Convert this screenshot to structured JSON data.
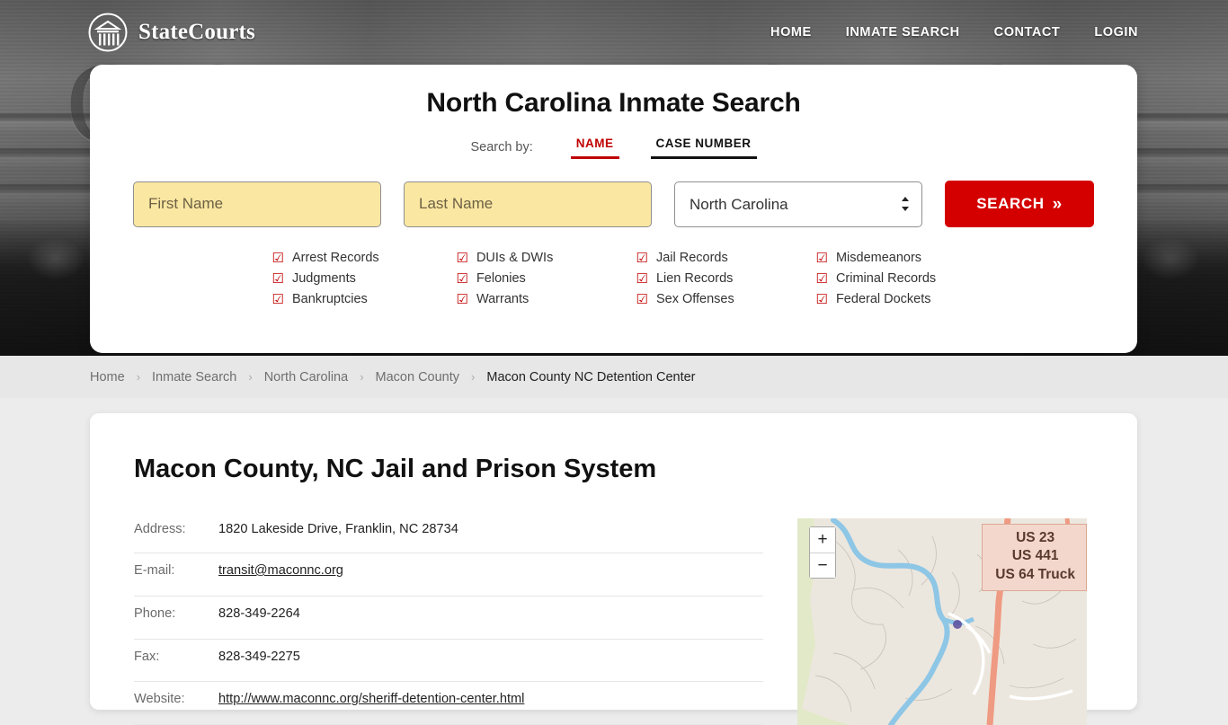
{
  "header": {
    "brand": "StateCourts",
    "logo_icon": "courthouse-logo-icon",
    "background_word": "COURTHOUSE",
    "nav": [
      {
        "label": "HOME"
      },
      {
        "label": "INMATE SEARCH"
      },
      {
        "label": "CONTACT"
      },
      {
        "label": "LOGIN"
      }
    ]
  },
  "search": {
    "title": "North Carolina Inmate Search",
    "search_by_label": "Search by:",
    "tabs": [
      {
        "label": "NAME",
        "active": true
      },
      {
        "label": "CASE NUMBER",
        "active": false
      }
    ],
    "first_name_placeholder": "First Name",
    "first_name_value": "",
    "last_name_placeholder": "Last Name",
    "last_name_value": "",
    "state_selected": "North Carolina",
    "state_options": [
      "North Carolina"
    ],
    "submit_label": "SEARCH",
    "submit_chevron": "»",
    "accent_red": "#d40000",
    "field_yellow": "#fae7a2",
    "checkbox_glyph": "☑",
    "record_types": [
      "Arrest Records",
      "DUIs & DWIs",
      "Jail Records",
      "Misdemeanors",
      "Judgments",
      "Felonies",
      "Lien Records",
      "Criminal Records",
      "Bankruptcies",
      "Warrants",
      "Sex Offenses",
      "Federal Dockets"
    ]
  },
  "breadcrumb": {
    "separator": "›",
    "items": [
      {
        "label": "Home",
        "current": false
      },
      {
        "label": "Inmate Search",
        "current": false
      },
      {
        "label": "North Carolina",
        "current": false
      },
      {
        "label": "Macon County",
        "current": false
      },
      {
        "label": "Macon County NC Detention Center",
        "current": true
      }
    ]
  },
  "facility": {
    "title": "Macon County, NC Jail and Prison System",
    "details": [
      {
        "label": "Address:",
        "value": "1820 Lakeside Drive, Franklin, NC 28734",
        "link": false
      },
      {
        "label": "E-mail:",
        "value": "transit@maconnc.org",
        "link": true
      },
      {
        "label": "Phone:",
        "value": "828-349-2264",
        "link": false
      },
      {
        "label": "Fax:",
        "value": "828-349-2275",
        "link": false
      },
      {
        "label": "Website:",
        "value": "http://www.maconnc.org/sheriff-detention-center.html",
        "link": true
      }
    ]
  },
  "map": {
    "zoom_in_label": "+",
    "zoom_out_label": "−",
    "route_shield_lines": [
      "US 23",
      "US 441",
      "US 64 Truck"
    ]
  }
}
